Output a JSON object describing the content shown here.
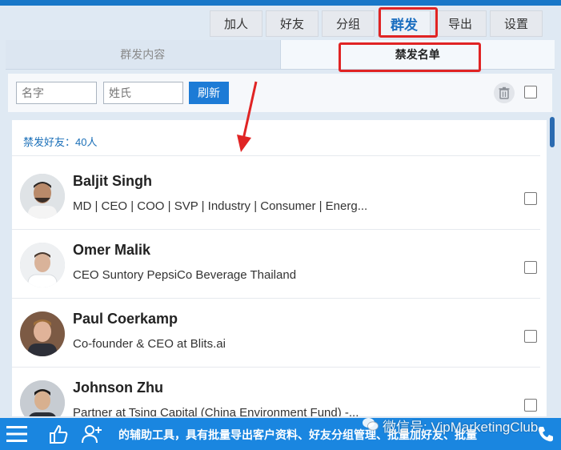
{
  "nav": {
    "items": [
      {
        "label": "加人"
      },
      {
        "label": "好友"
      },
      {
        "label": "分组"
      },
      {
        "label": "群发"
      },
      {
        "label": "导出"
      },
      {
        "label": "设置"
      }
    ],
    "active": "群发"
  },
  "subtabs": [
    {
      "label": "群发内容"
    },
    {
      "label": "禁发名单"
    }
  ],
  "filter": {
    "first_name_placeholder": "名字",
    "last_name_placeholder": "姓氏",
    "refresh_label": "刷新"
  },
  "list": {
    "count_label": "禁发好友：40人",
    "contacts": [
      {
        "name": "Baljit Singh",
        "title": "MD | CEO | COO | SVP | Industry | Consumer | Energ..."
      },
      {
        "name": "Omer Malik",
        "title": "CEO Suntory PepsiCo Beverage Thailand"
      },
      {
        "name": "Paul Coerkamp",
        "title": "Co-founder & CEO at Blits.ai"
      },
      {
        "name": "Johnson Zhu",
        "title": "Partner at Tsing Capital (China Environment Fund) -..."
      }
    ]
  },
  "bottombar": {
    "ticker": "的辅助工具，具有批量导出客户资料、好友分组管理、批量加好友、批量",
    "watermark": "微信号: VipMarketingClub"
  },
  "colors": {
    "accent": "#1c6fc0",
    "highlight": "#e02424",
    "bar": "#1a86e0"
  }
}
